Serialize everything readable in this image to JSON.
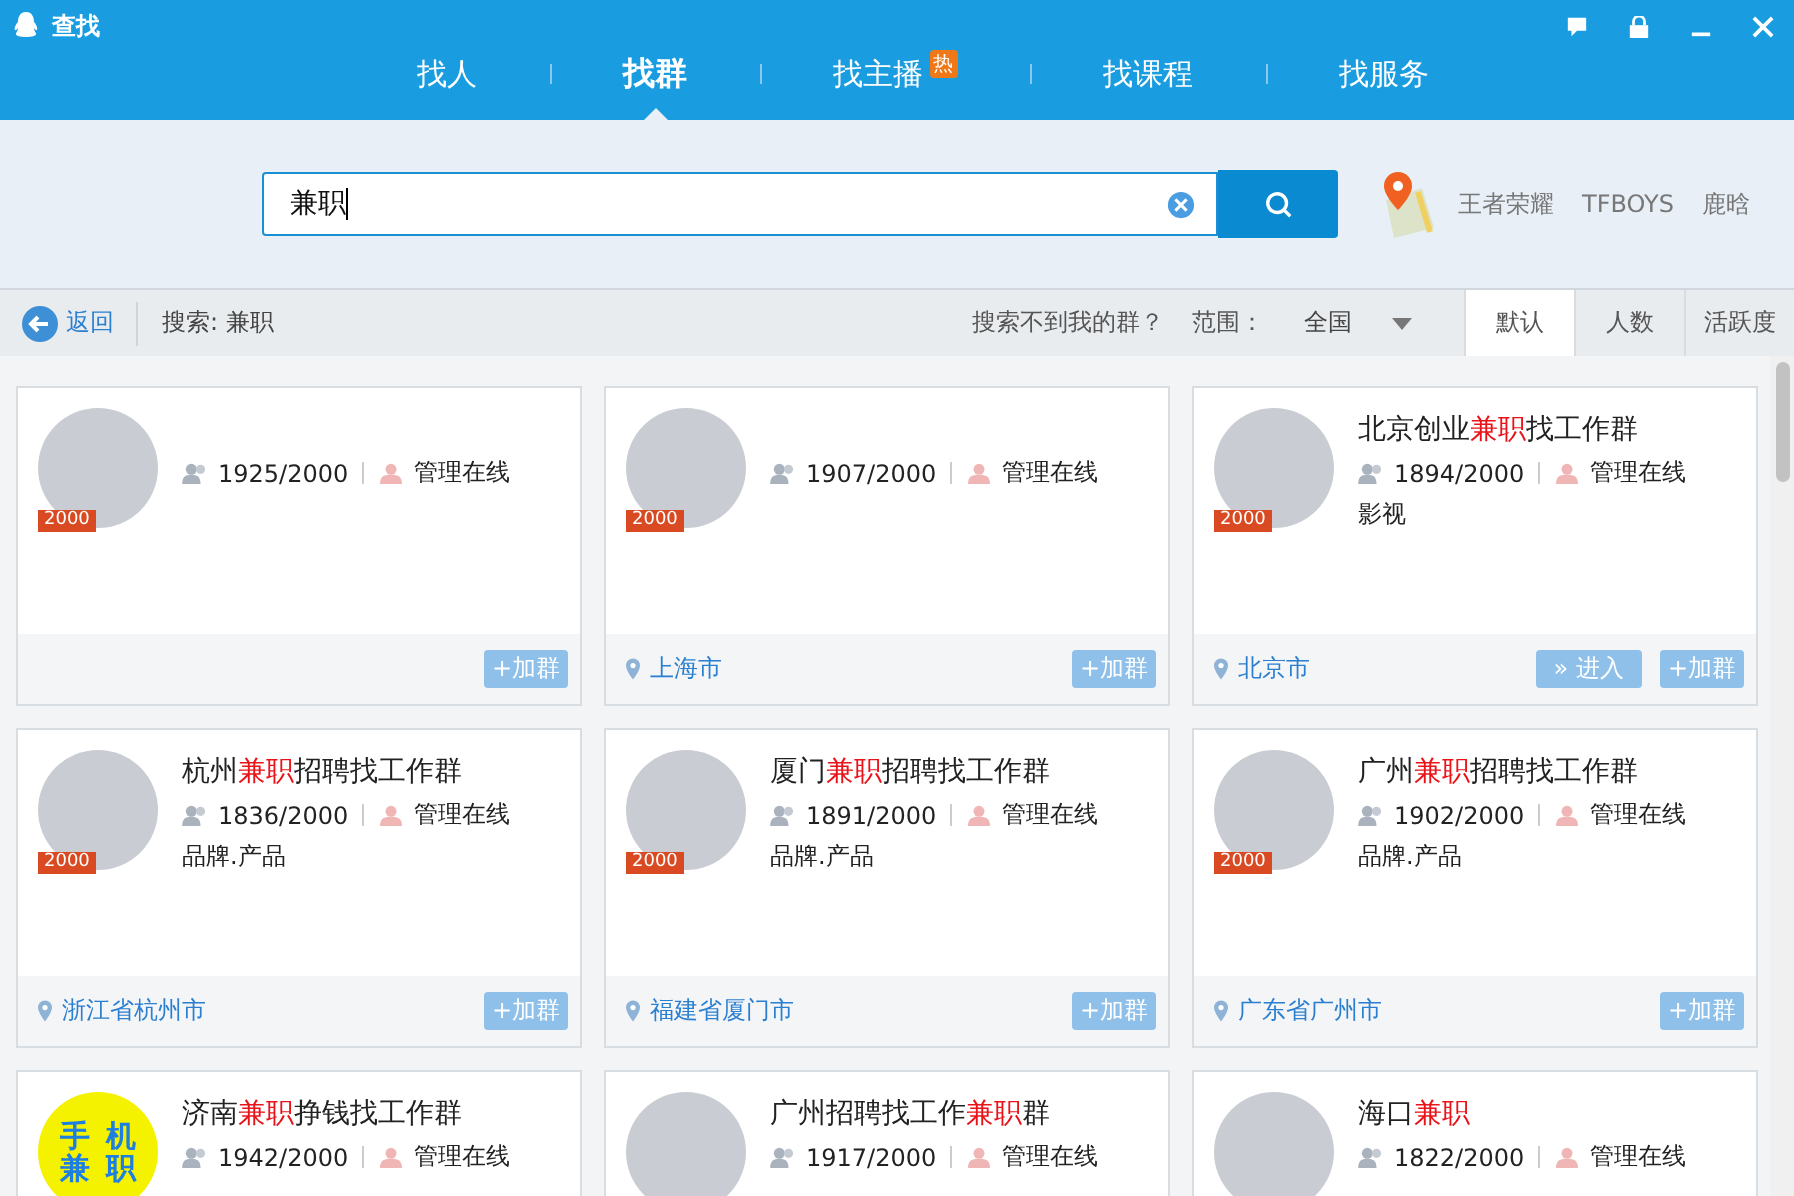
{
  "window": {
    "title": "查找"
  },
  "tabs": [
    {
      "label": "找人",
      "selected": false
    },
    {
      "label": "找群",
      "selected": true
    },
    {
      "label": "找主播",
      "selected": false,
      "badge": "热"
    },
    {
      "label": "找课程",
      "selected": false
    },
    {
      "label": "找服务",
      "selected": false
    }
  ],
  "search": {
    "value": "兼职"
  },
  "hot_keywords": [
    "王者荣耀",
    "TFBOYS",
    "鹿晗"
  ],
  "filter_bar": {
    "back": "返回",
    "query": "搜索: 兼职",
    "help": "搜索不到我的群？",
    "scope_label": "范围：",
    "scope_value": "全国",
    "sorts": [
      {
        "label": "默认",
        "selected": true
      },
      {
        "label": "人数",
        "selected": false
      },
      {
        "label": "活跃度",
        "selected": false
      }
    ]
  },
  "cards": [
    {
      "level": "2000",
      "members": "1925/2000",
      "admin": "管理在线",
      "buttons": [
        {
          "kind": "join",
          "label": "+加群"
        }
      ]
    },
    {
      "level": "2000",
      "members": "1907/2000",
      "admin": "管理在线",
      "location": "上海市",
      "buttons": [
        {
          "kind": "join",
          "label": "+加群"
        }
      ]
    },
    {
      "level": "2000",
      "title": [
        {
          "text": "北京创业",
          "highlight": false
        },
        {
          "text": "兼职",
          "highlight": true
        },
        {
          "text": "找工作群",
          "highlight": false
        }
      ],
      "members": "1894/2000",
      "admin": "管理在线",
      "tags": "影视",
      "location": "北京市",
      "buttons": [
        {
          "kind": "enter",
          "label": "» 进入"
        },
        {
          "kind": "join",
          "label": "+加群"
        }
      ]
    },
    {
      "level": "2000",
      "title": [
        {
          "text": "杭州",
          "highlight": false
        },
        {
          "text": "兼职",
          "highlight": true
        },
        {
          "text": "招聘找工作群",
          "highlight": false
        }
      ],
      "members": "1836/2000",
      "admin": "管理在线",
      "tags": "品牌.产品",
      "location": "浙江省杭州市",
      "buttons": [
        {
          "kind": "join",
          "label": "+加群"
        }
      ]
    },
    {
      "level": "2000",
      "title": [
        {
          "text": "厦门",
          "highlight": false
        },
        {
          "text": "兼职",
          "highlight": true
        },
        {
          "text": "招聘找工作群",
          "highlight": false
        }
      ],
      "members": "1891/2000",
      "admin": "管理在线",
      "tags": "品牌.产品",
      "location": "福建省厦门市",
      "buttons": [
        {
          "kind": "join",
          "label": "+加群"
        }
      ]
    },
    {
      "level": "2000",
      "title": [
        {
          "text": "广州",
          "highlight": false
        },
        {
          "text": "兼职",
          "highlight": true
        },
        {
          "text": "招聘找工作群",
          "highlight": false
        }
      ],
      "members": "1902/2000",
      "admin": "管理在线",
      "tags": "品牌.产品",
      "location": "广东省广州市",
      "buttons": [
        {
          "kind": "join",
          "label": "+加群"
        }
      ]
    },
    {
      "avatar_text": [
        "手",
        "机",
        "兼",
        "职"
      ],
      "title": [
        {
          "text": "济南",
          "highlight": false
        },
        {
          "text": "兼职",
          "highlight": true
        },
        {
          "text": "挣钱找工作群",
          "highlight": false
        }
      ],
      "members": "1942/2000",
      "admin": "管理在线"
    },
    {
      "title": [
        {
          "text": "广州招聘找工作",
          "highlight": false
        },
        {
          "text": "兼职",
          "highlight": true
        },
        {
          "text": "群",
          "highlight": false
        }
      ],
      "members": "1917/2000",
      "admin": "管理在线"
    },
    {
      "title": [
        {
          "text": "海口",
          "highlight": false
        },
        {
          "text": "兼职",
          "highlight": true
        }
      ],
      "members": "1822/2000",
      "admin": "管理在线"
    }
  ]
}
